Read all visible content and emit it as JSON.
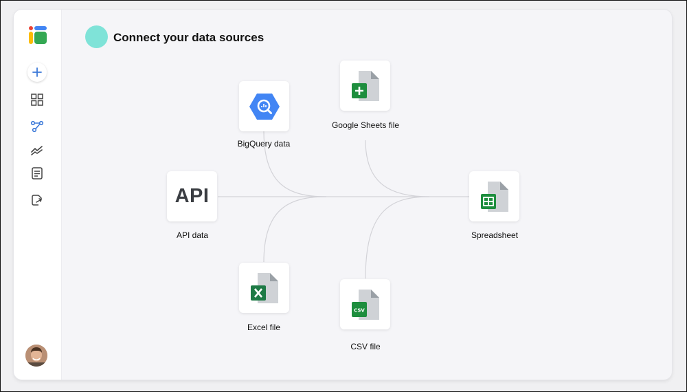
{
  "page": {
    "title": "Connect your data sources"
  },
  "sidebar": {
    "items": [
      {
        "name": "new",
        "icon": "plus-icon"
      },
      {
        "name": "dashboard",
        "icon": "grid-icon"
      },
      {
        "name": "data-flow",
        "icon": "flow-icon",
        "active": true
      },
      {
        "name": "trends",
        "icon": "trend-icon"
      },
      {
        "name": "reports",
        "icon": "list-icon"
      },
      {
        "name": "export",
        "icon": "export-icon"
      }
    ]
  },
  "diagram": {
    "sources": [
      {
        "id": "bigquery",
        "label": "BigQuery data",
        "icon": "bigquery-icon"
      },
      {
        "id": "sheets",
        "label": "Google Sheets file",
        "icon": "google-sheets-icon"
      },
      {
        "id": "api",
        "label": "API data",
        "icon_text": "API"
      },
      {
        "id": "excel",
        "label": "Excel file",
        "icon": "excel-file-icon"
      },
      {
        "id": "csv",
        "label": "CSV file",
        "icon": "csv-file-icon"
      }
    ],
    "target": {
      "id": "spreadsheet",
      "label": "Spreadsheet",
      "icon": "spreadsheet-icon"
    }
  },
  "colors": {
    "accent_dot": "#7fe3d8",
    "sheets_green": "#1e8e3e",
    "excel_green": "#1d7a45",
    "bigquery_blue": "#4285f4",
    "nav_active": "#3b78d8",
    "connector": "#d3d3d8"
  }
}
